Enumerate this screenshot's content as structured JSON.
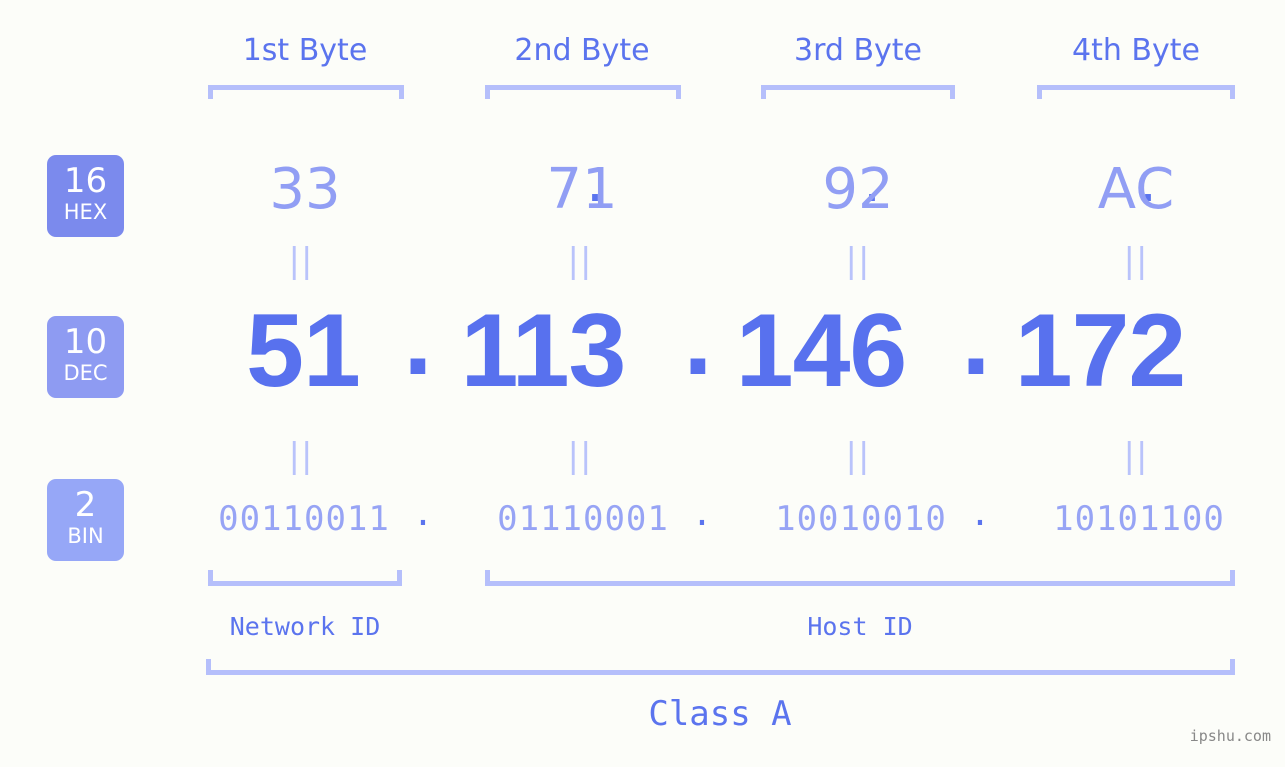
{
  "watermark": "ipshu.com",
  "byte_headers": [
    {
      "label": "1st Byte"
    },
    {
      "label": "2nd Byte"
    },
    {
      "label": "3rd Byte"
    },
    {
      "label": "4th Byte"
    }
  ],
  "bases": [
    {
      "number": "16",
      "name": "HEX",
      "color": "#7b8aed"
    },
    {
      "number": "10",
      "name": "DEC",
      "color": "#8e9bf2"
    },
    {
      "number": "2",
      "name": "BIN",
      "color": "#96a7f7"
    }
  ],
  "rows": {
    "hex": {
      "values": [
        "33",
        "71",
        "92",
        "AC"
      ],
      "separator": ".",
      "color": "#919ef4"
    },
    "dec": {
      "values": [
        "51",
        "113",
        "146",
        "172"
      ],
      "separator": ".",
      "color": "#5871ee"
    },
    "bin": {
      "values": [
        "00110011",
        "01110001",
        "10010010",
        "10101100"
      ],
      "separator": ".",
      "color": "#97a4f5"
    }
  },
  "equals_symbol": "||",
  "equals": {
    "hex_to_dec": [
      "||",
      "||",
      "||",
      "||"
    ],
    "dec_to_bin": [
      "||",
      "||",
      "||",
      "||"
    ]
  },
  "segments": {
    "network_id": "Network ID",
    "host_id": "Host ID"
  },
  "class_label": "Class A",
  "colors": {
    "background": "#fcfdf9",
    "accent": "#5b74ee",
    "bracket": "#b5bffb",
    "muted": "#919ef4"
  },
  "address": {
    "dec_full": "51.113.146.172",
    "hex_full": "33.71.92.AC",
    "bin_full": "00110011.01110001.10010010.10101100"
  }
}
